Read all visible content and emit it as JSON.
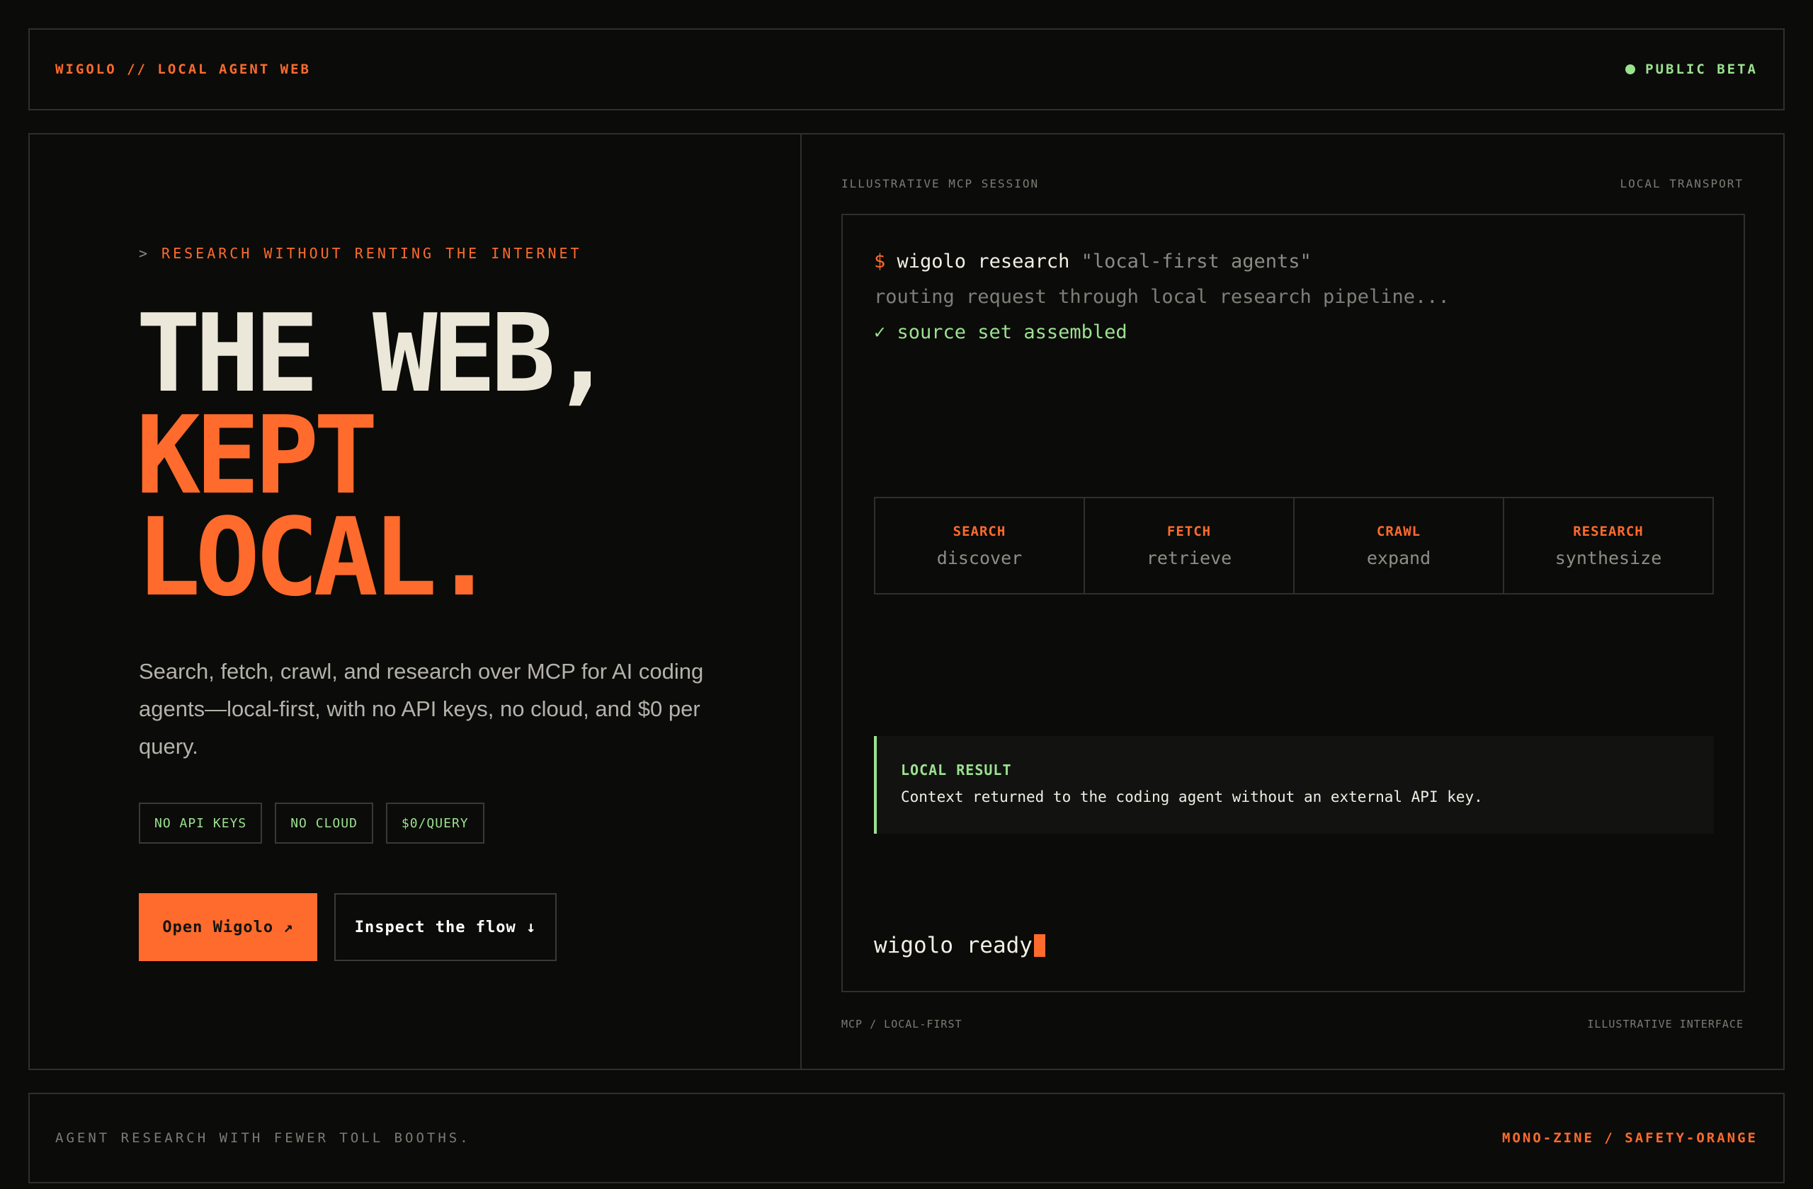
{
  "topbar": {
    "brand": "WIGOLO // LOCAL AGENT WEB",
    "status": "PUBLIC BETA"
  },
  "hero": {
    "eyebrow_prefix": ">",
    "eyebrow": "RESEARCH WITHOUT RENTING THE INTERNET",
    "headline_line1": "THE WEB,",
    "headline_line2": "KEPT",
    "headline_line3": "LOCAL.",
    "description": "Search, fetch, crawl, and research over MCP for AI coding agents—local-first, with no API keys, no cloud, and $0 per query.",
    "tags": [
      "NO API KEYS",
      "NO CLOUD",
      "$0/QUERY"
    ],
    "primary_cta": "Open Wigolo ↗",
    "secondary_cta": "Inspect the flow ↓"
  },
  "session": {
    "label_left": "ILLUSTRATIVE MCP SESSION",
    "label_right": "LOCAL TRANSPORT",
    "prompt": "$",
    "command": "wigolo research",
    "argument": "\"local-first agents\"",
    "log_line": "routing request through local research pipeline...",
    "success_line": "✓ source set assembled",
    "stages": [
      {
        "name": "SEARCH",
        "verb": "discover"
      },
      {
        "name": "FETCH",
        "verb": "retrieve"
      },
      {
        "name": "CRAWL",
        "verb": "expand"
      },
      {
        "name": "RESEARCH",
        "verb": "synthesize"
      }
    ],
    "result_title": "LOCAL RESULT",
    "result_body": "Context returned to the coding agent without an external API key.",
    "ready_text": "wigolo ready",
    "footer_left": "MCP / LOCAL-FIRST",
    "footer_right": "ILLUSTRATIVE INTERFACE"
  },
  "footer": {
    "tagline": "AGENT RESEARCH WITH FEWER TOLL BOOTHS.",
    "theme": "MONO-ZINE / SAFETY-ORANGE"
  },
  "colors": {
    "background": "#0b0b09",
    "accent": "#ff6b2c",
    "success": "#9be28f",
    "border": "#2f2f2b"
  }
}
